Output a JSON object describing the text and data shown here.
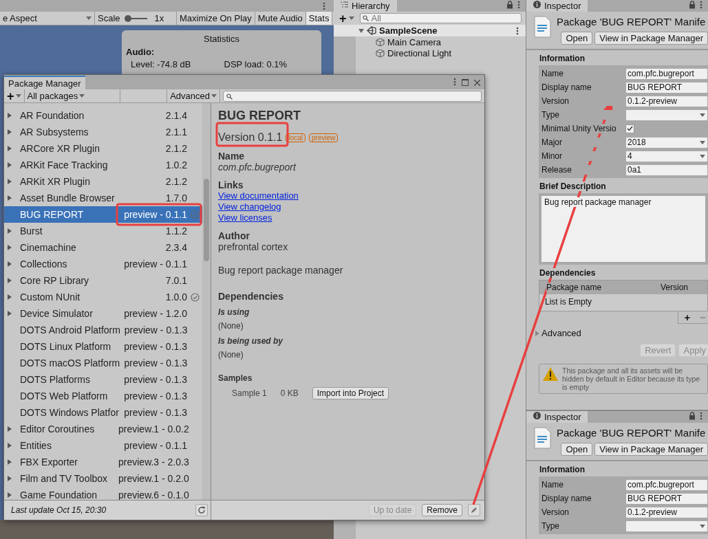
{
  "game_view": {
    "toolbar": {
      "aspect": "e Aspect",
      "scale": {
        "label": "Scale",
        "level": 0,
        "value": "1x"
      },
      "buttons": [
        {
          "label": "Maximize On Play",
          "selected": false
        },
        {
          "label": "Mute Audio",
          "selected": false
        },
        {
          "label": "Stats",
          "selected": true
        }
      ]
    },
    "statistics": {
      "title": "Statistics",
      "section": "Audio:",
      "items": [
        "Level: -74.8 dB",
        "DSP load: 0.1%"
      ]
    }
  },
  "hierarchy": {
    "tab": "Hierarchy",
    "add": "+",
    "search_placeholder": "All",
    "scene": {
      "name": "SampleScene",
      "expanded": true
    },
    "objects": [
      "Main Camera",
      "Directional Light"
    ]
  },
  "package_manager": {
    "tab": "Package Manager",
    "toolbar": {
      "add": "+",
      "filter": "All packages",
      "advanced": "Advanced"
    },
    "packages": [
      {
        "name": "AR Foundation",
        "version": "2.1.4",
        "expandable": true,
        "installed": false,
        "selected": false
      },
      {
        "name": "AR Subsystems",
        "version": "2.1.1",
        "expandable": true,
        "installed": false,
        "selected": false
      },
      {
        "name": "ARCore XR Plugin",
        "version": "2.1.2",
        "expandable": true,
        "installed": false,
        "selected": false
      },
      {
        "name": "ARKit Face Tracking",
        "version": "1.0.2",
        "expandable": true,
        "installed": false,
        "selected": false
      },
      {
        "name": "ARKit XR Plugin",
        "version": "2.1.2",
        "expandable": true,
        "installed": false,
        "selected": false
      },
      {
        "name": "Asset Bundle Browser",
        "version": "1.7.0",
        "expandable": true,
        "installed": false,
        "selected": false
      },
      {
        "name": "BUG REPORT",
        "version": "preview - 0.1.1",
        "expandable": false,
        "installed": true,
        "selected": true
      },
      {
        "name": "Burst",
        "version": "1.1.2",
        "expandable": true,
        "installed": false,
        "selected": false
      },
      {
        "name": "Cinemachine",
        "version": "2.3.4",
        "expandable": true,
        "installed": false,
        "selected": false
      },
      {
        "name": "Collections",
        "version": "preview - 0.1.1",
        "expandable": true,
        "installed": false,
        "selected": false
      },
      {
        "name": "Core RP Library",
        "version": "7.0.1",
        "expandable": true,
        "installed": false,
        "selected": false
      },
      {
        "name": "Custom NUnit",
        "version": "1.0.0",
        "expandable": true,
        "installed": true,
        "selected": false
      },
      {
        "name": "Device Simulator",
        "version": "preview - 1.2.0",
        "expandable": true,
        "installed": false,
        "selected": false
      },
      {
        "name": "DOTS Android Platform",
        "version": "preview - 0.1.3",
        "expandable": false,
        "installed": false,
        "selected": false
      },
      {
        "name": "DOTS Linux Platform",
        "version": "preview - 0.1.3",
        "expandable": false,
        "installed": false,
        "selected": false
      },
      {
        "name": "DOTS macOS Platform",
        "version": "preview - 0.1.3",
        "expandable": false,
        "installed": false,
        "selected": false
      },
      {
        "name": "DOTS Platforms",
        "version": "preview - 0.1.3",
        "expandable": false,
        "installed": false,
        "selected": false
      },
      {
        "name": "DOTS Web Platform",
        "version": "preview - 0.1.3",
        "expandable": false,
        "installed": false,
        "selected": false
      },
      {
        "name": "DOTS Windows Platfor",
        "version": "preview - 0.1.3",
        "expandable": false,
        "installed": false,
        "selected": false
      },
      {
        "name": "Editor Coroutines",
        "version": "preview.1 - 0.0.2",
        "expandable": true,
        "installed": false,
        "selected": false
      },
      {
        "name": "Entities",
        "version": "preview - 0.1.1",
        "expandable": true,
        "installed": false,
        "selected": false
      },
      {
        "name": "FBX Exporter",
        "version": "preview.3 - 2.0.3",
        "expandable": true,
        "installed": false,
        "selected": false
      },
      {
        "name": "Film and TV Toolbox",
        "version": "preview.1 - 0.2.0",
        "expandable": true,
        "installed": false,
        "selected": false
      },
      {
        "name": "Game Foundation",
        "version": "preview.6 - 0.1.0",
        "expandable": true,
        "installed": false,
        "selected": false
      }
    ],
    "status": "Last update Oct 15, 20:30",
    "details": {
      "title": "BUG REPORT",
      "version": "Version 0.1.1",
      "tags": [
        "local",
        "preview"
      ],
      "name_heading": "Name",
      "name": "com.pfc.bugreport",
      "links_heading": "Links",
      "links": [
        "View documentation",
        "View changelog",
        "View licenses"
      ],
      "author_heading": "Author",
      "author": "prefrontal cortex",
      "description": "Bug report package manager",
      "dependencies_heading": "Dependencies",
      "dependency_groups": [
        {
          "heading": "Is using",
          "value": "(None)"
        },
        {
          "heading": "Is being used by",
          "value": "(None)"
        }
      ],
      "samples_heading": "Samples",
      "samples": [
        {
          "name": "Sample 1",
          "size": "0 KB",
          "action": "Import into Project"
        }
      ]
    },
    "footer_buttons": [
      {
        "label": "Up to date",
        "disabled": true
      },
      {
        "label": "Remove",
        "disabled": false
      }
    ]
  },
  "inspectors": [
    {
      "tab": "Inspector",
      "title": "Package 'BUG REPORT' Manife",
      "buttons": [
        "Open",
        "View in Package Manager"
      ],
      "information_heading": "Information",
      "fields": [
        {
          "label": "Name",
          "kind": "text",
          "value": "com.pfc.bugreport"
        },
        {
          "label": "Display name",
          "kind": "text",
          "value": "BUG REPORT"
        },
        {
          "label": "Version",
          "kind": "text",
          "value": "0.1.2-preview"
        },
        {
          "label": "Type",
          "kind": "dropdown"
        },
        {
          "label": "Minimal Unity Versio",
          "kind": "checkbox",
          "checked": true
        },
        {
          "label": "Major",
          "kind": "dropdown",
          "value": "2018"
        },
        {
          "label": "Minor",
          "kind": "dropdown",
          "value": "4"
        },
        {
          "label": "Release",
          "kind": "text",
          "value": "0a1"
        }
      ],
      "brief_description": {
        "heading": "Brief Description",
        "text": "Bug report package manager"
      },
      "dependencies": {
        "heading": "Dependencies",
        "columns": [
          "Package name",
          "Version"
        ],
        "empty_text": "List is Empty",
        "add": "+",
        "remove": "−"
      },
      "advanced": {
        "label": "Advanced",
        "expanded": false
      },
      "actions": [
        {
          "label": "Revert",
          "disabled": true
        },
        {
          "label": "Apply",
          "disabled": true
        }
      ],
      "warning": "This package and all its assets will be hidden by default in Editor because its type is empty"
    },
    {
      "tab": "Inspector",
      "title": "Package 'BUG REPORT' Manife",
      "buttons": [
        "Open",
        "View in Package Manager"
      ],
      "information_heading": "Information",
      "fields": [
        {
          "label": "Name",
          "kind": "text",
          "value": "com.pfc.bugreport"
        },
        {
          "label": "Display name",
          "kind": "text",
          "value": "BUG REPORT"
        },
        {
          "label": "Version",
          "kind": "text",
          "value": "0.1.2-preview"
        },
        {
          "label": "Type",
          "kind": "dropdown"
        }
      ]
    }
  ]
}
